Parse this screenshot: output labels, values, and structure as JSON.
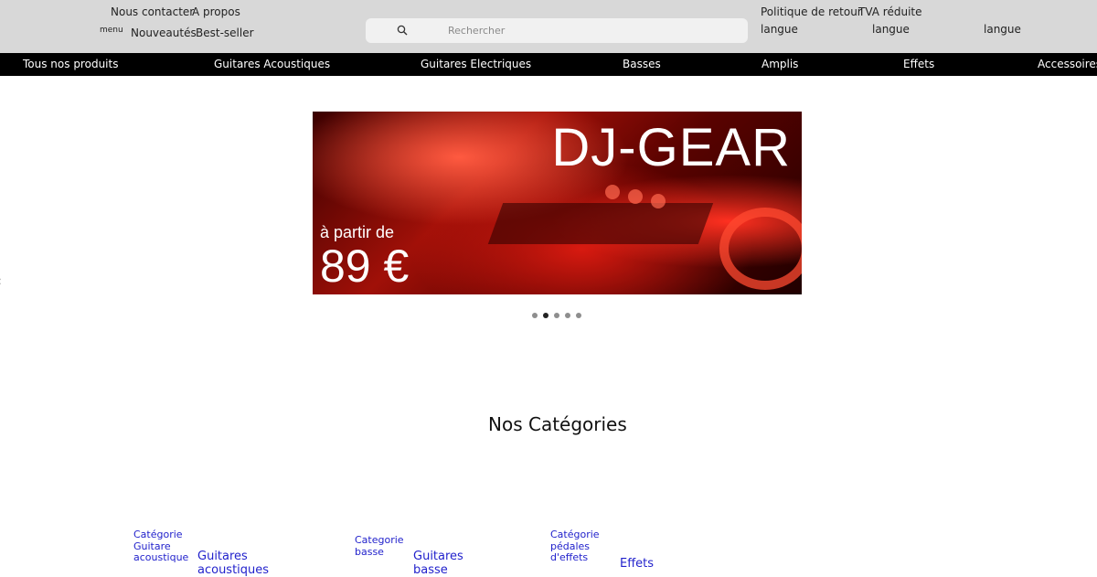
{
  "topbar": {
    "contact": "Nous contacter",
    "about": "A propos",
    "menu": "menu",
    "new": "Nouveautés",
    "bestseller": "Best-seller",
    "return_policy": "Politique de retour",
    "vat": "TVA réduite",
    "lang1": "langue",
    "lang2": "langue",
    "lang3": "langue"
  },
  "search": {
    "placeholder": "Rechercher",
    "icon": "search-icon"
  },
  "nav": [
    "Tous nos produits",
    "Guitares Acoustiques",
    "Guitares Electriques",
    "Basses",
    "Amplis",
    "Effets",
    "Accessoires"
  ],
  "banner": {
    "title": "DJ-GEAR",
    "subtitle": "à partir de",
    "price": "89 €"
  },
  "carousel": {
    "count": 5,
    "active": 2
  },
  "categories": {
    "heading": "Nos Catégories",
    "items": [
      {
        "image_alt": "Catégorie Guitare acoustique",
        "name": "Guitares acoustiques"
      },
      {
        "image_alt": "Categorie basse",
        "name": "Guitares basse"
      },
      {
        "image_alt": "Catégorie pédales d'effets",
        "name": "Effets"
      }
    ]
  }
}
